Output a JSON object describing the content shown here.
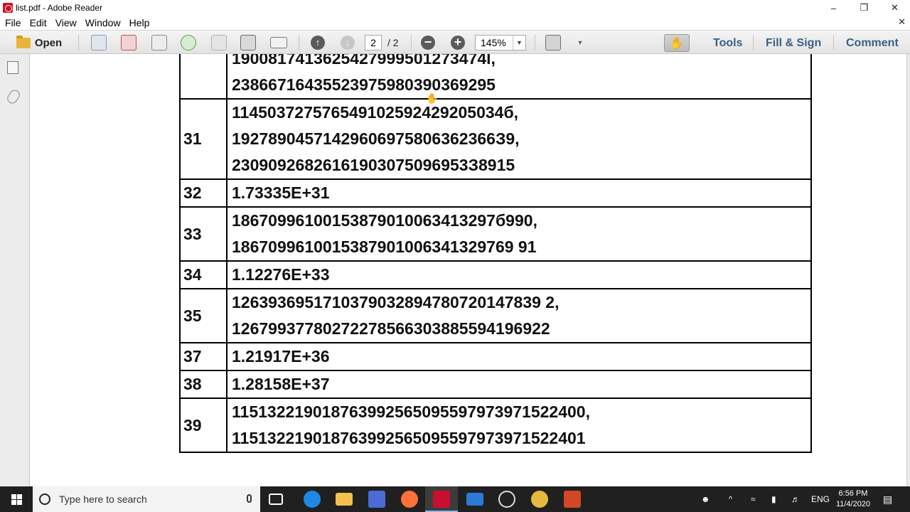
{
  "window": {
    "title": "list.pdf - Adobe Reader"
  },
  "menu": [
    "File",
    "Edit",
    "View",
    "Window",
    "Help"
  ],
  "toolbar": {
    "open_label": "Open",
    "page_current": "2",
    "page_total": "/ 2",
    "zoom": "145%",
    "tools_label": "Tools",
    "fill_sign_label": "Fill & Sign",
    "comment_label": "Comment"
  },
  "table": {
    "top_partial": {
      "lines": [
        "1900817413625427999501273474l,",
        "23866716435523975980390369295"
      ]
    },
    "rows": [
      {
        "num": "31",
        "lines": [
          "114503727576549102592429205034б,",
          "19278904571429606975806362366З9,",
          "23090926826161903075096953З8915"
        ]
      },
      {
        "num": "32",
        "lines": [
          "1.73335E+31"
        ]
      },
      {
        "num": "33",
        "lines": [
          "18670996100153879010063413297б990,",
          "1867099610015387901006341329769 91"
        ]
      },
      {
        "num": "34",
        "lines": [
          "1.12276E+33"
        ]
      },
      {
        "num": "35",
        "lines": [
          "1263936951710379032894780720147839 2,",
          "12679937780272278566303885594196922"
        ]
      },
      {
        "num": "37",
        "lines": [
          "1.21917E+36"
        ]
      },
      {
        "num": "38",
        "lines": [
          "1.28158E+37"
        ]
      },
      {
        "num": "39",
        "lines": [
          "115132219018763992565095597973971522400,",
          "115132219018763992565095597973971522401"
        ]
      }
    ]
  },
  "taskbar": {
    "search_placeholder": "Type here to search",
    "language": "ENG",
    "time": "6:56 PM",
    "date": "11/4/2020"
  },
  "colors": {
    "accent_link": "#3b5f87",
    "taskbar": "#202020",
    "acrobat_red": "#c8102e"
  }
}
